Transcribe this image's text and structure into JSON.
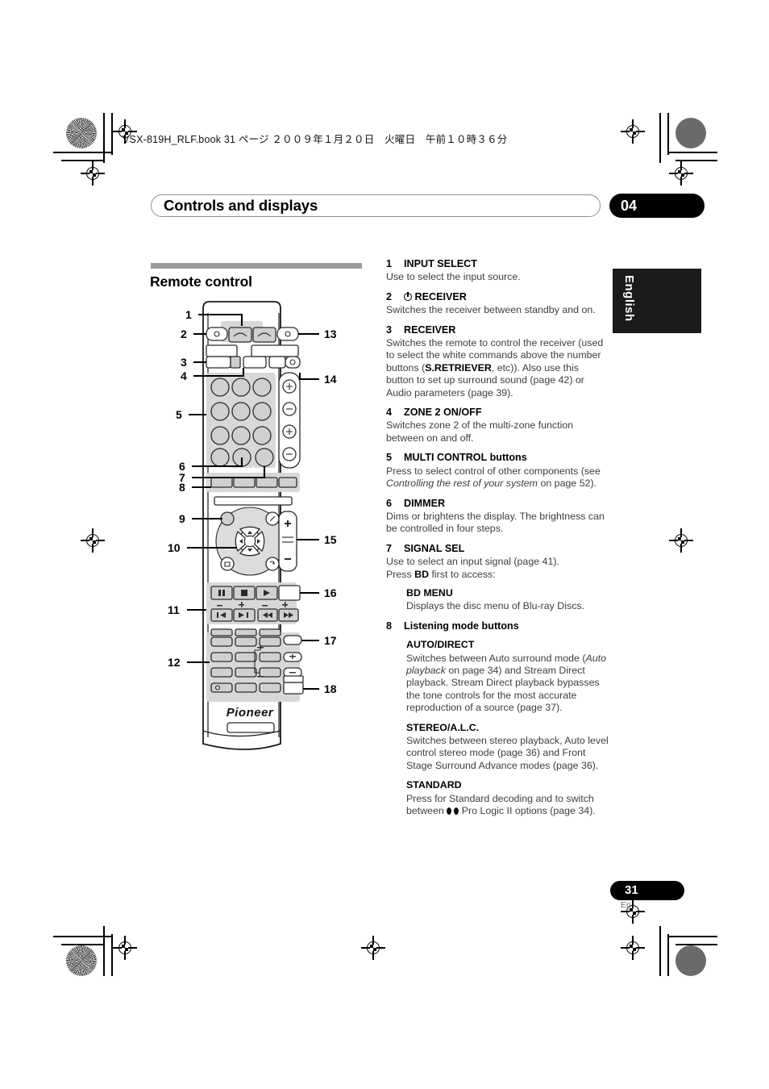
{
  "header": {
    "book_line": "VSX-819H_RLF.book   31 ページ   ２００９年１月２０日　火曜日　午前１０時３６分"
  },
  "chapter": {
    "title": "Controls and displays",
    "number": "04"
  },
  "side_tab": {
    "language": "English"
  },
  "section": {
    "title": "Remote control"
  },
  "figure": {
    "brand": "Pioneer",
    "callouts": [
      "1",
      "2",
      "3",
      "4",
      "5",
      "6",
      "7",
      "8",
      "9",
      "10",
      "11",
      "12",
      "13",
      "14",
      "15",
      "16",
      "17",
      "18"
    ]
  },
  "legend": [
    {
      "num": "1",
      "title": "INPUT SELECT",
      "body": "Use to select the input source."
    },
    {
      "num": "2",
      "title": "RECEIVER",
      "title_icon": "power-icon",
      "body": "Switches the receiver between standby and on."
    },
    {
      "num": "3",
      "title": "RECEIVER",
      "body_parts": [
        {
          "t": "Switches the remote to control the receiver (used to select the white commands above the number buttons ("
        },
        {
          "t": "S.RETRIEVER",
          "bold": true
        },
        {
          "t": ", etc)). Also use this button to set up surround sound (page 42) or Audio parameters (page 39)."
        }
      ]
    },
    {
      "num": "4",
      "title": "ZONE 2 ON/OFF",
      "body": "Switches zone 2 of the multi-zone function between on and off."
    },
    {
      "num": "5",
      "title": "MULTI CONTROL buttons",
      "body_parts": [
        {
          "t": "Press to select control of other components (see "
        },
        {
          "t": "Controlling the rest of your system",
          "italic": true
        },
        {
          "t": " on page 52)."
        }
      ]
    },
    {
      "num": "6",
      "title": "DIMMER",
      "body": "Dims or brightens the display. The brightness can be controlled in four steps."
    },
    {
      "num": "7",
      "title": "SIGNAL SEL",
      "body_parts": [
        {
          "t": "Use to select an input signal (page 41)."
        },
        {
          "t": "\n"
        },
        {
          "t": "Press "
        },
        {
          "t": "BD",
          "bold": true
        },
        {
          "t": " first to access:"
        }
      ],
      "subs": [
        {
          "sub_title": "BD MENU",
          "sub_body": "Displays the disc menu of Blu-ray Discs."
        }
      ]
    },
    {
      "num": "8",
      "title": "Listening mode buttons",
      "subs": [
        {
          "sub_title": "AUTO/DIRECT",
          "sub_parts": [
            {
              "t": "Switches between Auto surround mode ("
            },
            {
              "t": "Auto playback",
              "italic": true
            },
            {
              "t": " on page 34) and Stream Direct playback. Stream Direct playback bypasses the tone controls for the most accurate reproduction of a source (page 37)."
            }
          ]
        },
        {
          "sub_title": "STEREO/A.L.C.",
          "sub_body": "Switches between stereo playback, Auto level control stereo mode (page 36) and Front Stage Surround Advance modes (page 36)."
        },
        {
          "sub_title": "STANDARD",
          "sub_parts": [
            {
              "t": "Press for Standard decoding and to switch between "
            },
            {
              "t": "DOLBY",
              "icon": "dolby-logo-icon"
            },
            {
              "t": " Pro Logic II options (page 34)."
            }
          ]
        }
      ]
    }
  ],
  "footer": {
    "page_number": "31",
    "page_language": "En"
  }
}
